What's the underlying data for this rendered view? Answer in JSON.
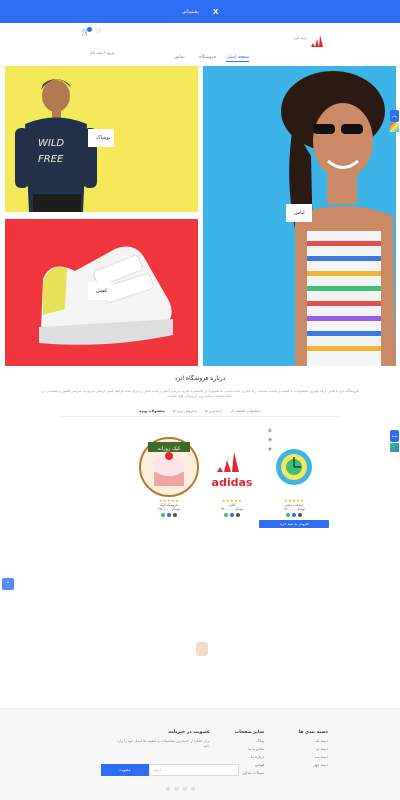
{
  "topbar": {
    "text": "پشتیبانی",
    "close": "X"
  },
  "header": {
    "brand": "برند ابرد",
    "login": "ورود / ثبت نام",
    "nav": [
      "صفحه اصلی",
      "فروشگاه",
      "تماس"
    ]
  },
  "tiles": {
    "top_left_label": "پوشاک",
    "bottom_left_label": "کفش",
    "right_label": "لباس"
  },
  "about": {
    "title": "درباره فروشگاه ابرد",
    "text": "فروشگاه ابرد با هدف ارائه بهترین محصولات با کیفیت و قیمت مناسب راه اندازی شده است. ما همواره در تلاشیم تا تجربه خریدی آسان و لذت بخش را برای شما فراهم کنیم. ارسال سریع به سراسر کشور و پشتیبانی در تمام ساعات شبانه روز از ویژگی های ماست.",
    "tabs": [
      "محصولات ویژه",
      "پرفروش ترین ها",
      "جدیدترین ها",
      "محصولات تخفیف دار"
    ]
  },
  "products": [
    {
      "name": "عروسک کیک",
      "price": "۲۵۰,۰۰۰ تومان",
      "badge": "کیک روزانه",
      "swatches": [
        "#3bc06b",
        "#2f6df3",
        "#555555"
      ]
    },
    {
      "name": "کتانی",
      "price": "۳۲۰,۰۰۰ تومان",
      "brand": "adidas",
      "swatches": [
        "#3bc06b",
        "#2f6df3",
        "#555555"
      ]
    },
    {
      "name": "ساعت مچی",
      "price": "۱۹۰,۰۰۰ تومان",
      "swatches": [
        "#3bc06b",
        "#2f6df3",
        "#555555"
      ],
      "cart": "افزودن به سبد خرید"
    }
  ],
  "side_buttons": [
    "پیام",
    "سبد"
  ],
  "footer": {
    "col1": {
      "title": "دسته بندی ها",
      "links": [
        "دسته یک",
        "دسته دو",
        "دسته سه",
        "دسته چهار"
      ]
    },
    "col2": {
      "title": "سایر صفحات",
      "links": [
        "وبلاگ",
        "تماس با ما",
        "درباره ما",
        "قوانین",
        "سوالات متداول"
      ]
    },
    "newsletter": {
      "title": "عضویت در خبرنامه",
      "text": "برای اطلاع از جدیدترین محصولات و تخفیف ها ایمیل خود را وارد کنید.",
      "placeholder": "ایمیل",
      "button": "عضویت"
    }
  },
  "colors": {
    "accent": "#2f6df3",
    "yellow": "#f6e85b",
    "red": "#f0353d",
    "cyan": "#3cb4e7"
  }
}
